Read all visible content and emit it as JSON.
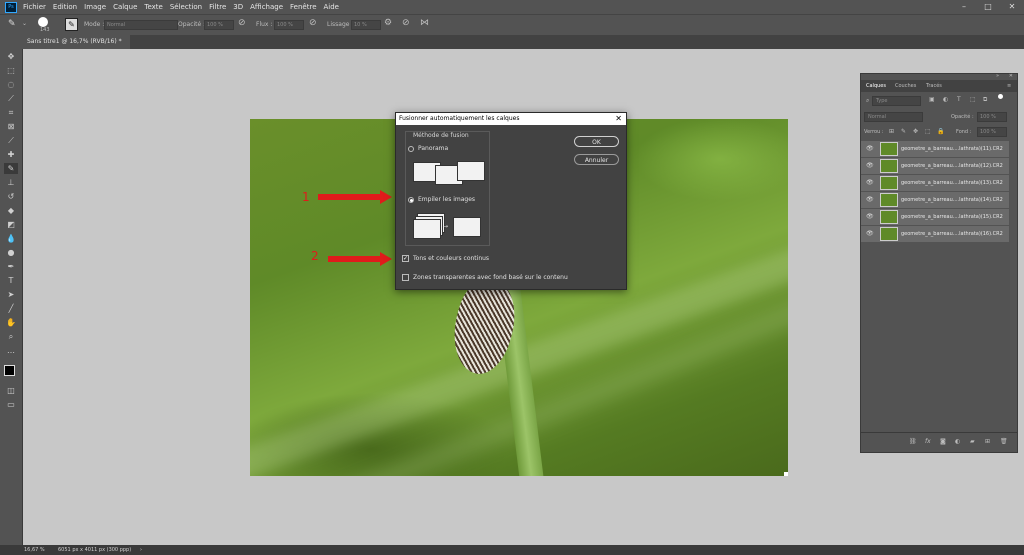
{
  "app": {
    "badge": "Ps"
  },
  "menu": [
    "Fichier",
    "Edition",
    "Image",
    "Calque",
    "Texte",
    "Sélection",
    "Filtre",
    "3D",
    "Affichage",
    "Fenêtre",
    "Aide"
  ],
  "window_controls": [
    "–",
    "□",
    "✕"
  ],
  "options": {
    "brush_size": "143",
    "mode_label": "Mode :",
    "mode_value": "Normal",
    "opacity_label": "Opacité :",
    "opacity_value": "100 %",
    "flow_label": "Flux :",
    "flow_value": "100 %",
    "smoothing_label": "Lissage :",
    "smoothing_value": "10 %"
  },
  "document": {
    "tab_title": "Sans titre1 @ 16,7% (RVB/16) *",
    "tab_close": "×"
  },
  "annotations": [
    "1",
    "2"
  ],
  "dialog": {
    "title": "Fusionner automatiquement les calques",
    "close": "✕",
    "group_label": "Méthode de fusion",
    "option_panorama": "Panorama",
    "option_stack": "Empiler les images",
    "selected_method": "Empiler les images",
    "checkbox_tones": "Tons et couleurs continus",
    "checkbox_tones_checked": true,
    "checkbox_transparent": "Zones transparentes avec fond basé sur le contenu",
    "checkbox_transparent_checked": false,
    "ok": "OK",
    "cancel": "Annuler"
  },
  "panel": {
    "tabs": [
      "Calques",
      "Couches",
      "Tracés"
    ],
    "filter_placeholder": "Type",
    "blend_mode": "Normal",
    "opacity_label": "Opacité :",
    "opacity_value": "100 %",
    "lock_label": "Verrou :",
    "fill_label": "Fond :",
    "fill_value": "100 %",
    "layers": [
      "geometre_a_barreau....lathrata)(11).CR2",
      "geometre_a_barreau....lathrata)(12).CR2",
      "geometre_a_barreau....lathrata)(13).CR2",
      "geometre_a_barreau....lathrata)(14).CR2",
      "geometre_a_barreau....lathrata)(15).CR2",
      "geometre_a_barreau....lathrata)(16).CR2"
    ],
    "footer_icons": [
      "link-icon",
      "fx-icon",
      "mask-icon",
      "adjustment-icon",
      "folder-icon",
      "new-layer-icon",
      "trash-icon"
    ]
  },
  "status": {
    "zoom": "16,67 %",
    "doc_info": "6051 px x 4011 px (300 ppp)",
    "arrow": "›"
  },
  "colors": {
    "chrome": "#535353",
    "dark": "#424242",
    "accent_red": "#e01b1b",
    "canvas": "#c8c8c8"
  }
}
